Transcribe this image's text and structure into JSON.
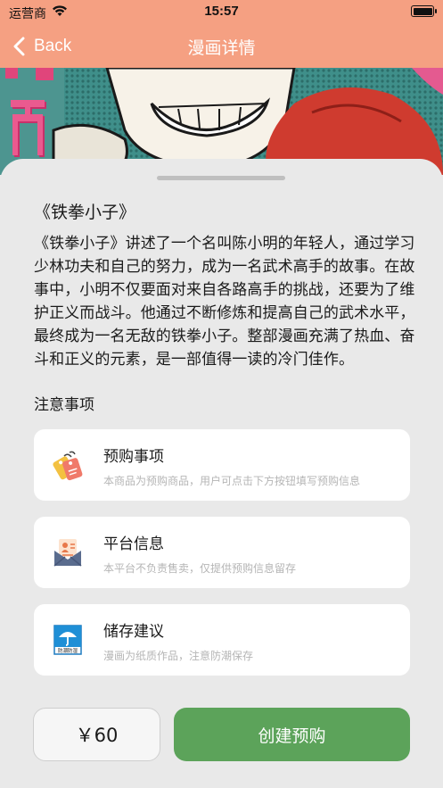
{
  "status_bar": {
    "carrier": "运营商",
    "time": "15:57"
  },
  "nav": {
    "back_label": "Back",
    "title": "漫画详情"
  },
  "detail": {
    "title": "《铁拳小子》",
    "description": "《铁拳小子》讲述了一个名叫陈小明的年轻人，通过学习少林功夫和自己的努力，成为一名武术高手的故事。在故事中，小明不仅要面对来自各路高手的挑战，还要为了维护正义而战斗。他通过不断修炼和提高自己的武术水平，最终成为一名无敌的铁拳小子。整部漫画充满了热血、奋斗和正义的元素，是一部值得一读的冷门佳作。"
  },
  "notices": {
    "heading": "注意事项",
    "items": [
      {
        "icon": "price-tags-icon",
        "title": "预购事项",
        "desc": "本商品为预购商品，用户可点击下方按钮填写预购信息"
      },
      {
        "icon": "platform-mail-icon",
        "title": "平台信息",
        "desc": "本平台不负责售卖，仅提供预购信息留存"
      },
      {
        "icon": "moisture-umbrella-icon",
        "title": "储存建议",
        "desc": "漫画为纸质作品，注意防潮保存",
        "icon_caption": "防潮防湿"
      }
    ]
  },
  "footer": {
    "price": "￥60",
    "create_label": "创建预购"
  },
  "colors": {
    "header_bg": "#f5a082",
    "accent_green": "#5ca35a",
    "sheet_bg": "#e9e9e9"
  }
}
